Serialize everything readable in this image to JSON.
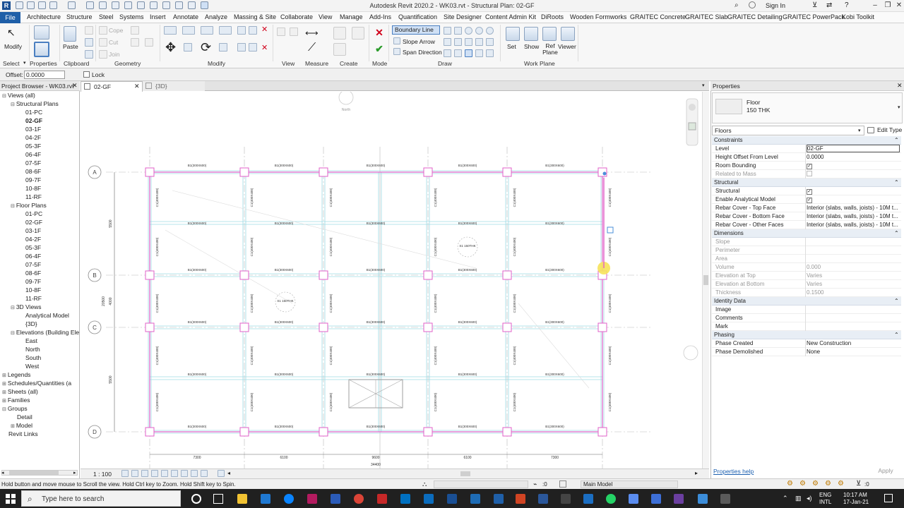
{
  "title": "Autodesk Revit 2020.2 - WK03.rvt - Structural Plan: 02-GF",
  "signin": "Sign In",
  "menu": [
    "File",
    "Architecture",
    "Structure",
    "Steel",
    "Systems",
    "Insert",
    "Annotate",
    "Analyze",
    "Massing & Site",
    "Collaborate",
    "View",
    "Manage",
    "Add-Ins",
    "Quantification",
    "Site Designer",
    "Content Admin Kit",
    "DiRoots",
    "Wooden Formworks",
    "GRAITEC Concrete",
    "GRAITEC Slab",
    "GRAITEC Detailing",
    "GRAITEC PowerPack",
    "Kobi Toolkit"
  ],
  "ribbon": {
    "modify": "Modify",
    "paste": "Paste",
    "cope": "Cope",
    "cut": "Cut",
    "join": "Join",
    "boundary_line": "Boundary Line",
    "slope_arrow": "Slope Arrow",
    "span_direction": "Span Direction",
    "set": "Set",
    "show": "Show",
    "ref_plane": "Ref Plane",
    "viewer": "Viewer",
    "groups": {
      "select": "Select",
      "properties": "Properties",
      "clipboard": "Clipboard",
      "geometry": "Geometry",
      "modify": "Modify",
      "view": "View",
      "measure": "Measure",
      "create": "Create",
      "mode": "Mode",
      "draw": "Draw",
      "work_plane": "Work Plane"
    }
  },
  "options": {
    "offset_label": "Offset:",
    "offset_value": "0.0000",
    "lock_label": "Lock"
  },
  "project_browser": {
    "title": "Project Browser - WK03.rvt",
    "items": [
      {
        "label": "Views (all)",
        "indent": 0,
        "tw": "⊟"
      },
      {
        "label": "Structural Plans",
        "indent": 1,
        "tw": "⊟"
      },
      {
        "label": "01-PC",
        "indent": 2
      },
      {
        "label": "02-GF",
        "indent": 2,
        "bold": true
      },
      {
        "label": "03-1F",
        "indent": 2
      },
      {
        "label": "04-2F",
        "indent": 2
      },
      {
        "label": "05-3F",
        "indent": 2
      },
      {
        "label": "06-4F",
        "indent": 2
      },
      {
        "label": "07-5F",
        "indent": 2
      },
      {
        "label": "08-6F",
        "indent": 2
      },
      {
        "label": "09-7F",
        "indent": 2
      },
      {
        "label": "10-8F",
        "indent": 2
      },
      {
        "label": "11-RF",
        "indent": 2
      },
      {
        "label": "Floor Plans",
        "indent": 1,
        "tw": "⊟"
      },
      {
        "label": "01-PC",
        "indent": 2
      },
      {
        "label": "02-GF",
        "indent": 2
      },
      {
        "label": "03-1F",
        "indent": 2
      },
      {
        "label": "04-2F",
        "indent": 2
      },
      {
        "label": "05-3F",
        "indent": 2
      },
      {
        "label": "06-4F",
        "indent": 2
      },
      {
        "label": "07-5F",
        "indent": 2
      },
      {
        "label": "08-6F",
        "indent": 2
      },
      {
        "label": "09-7F",
        "indent": 2
      },
      {
        "label": "10-8F",
        "indent": 2
      },
      {
        "label": "11-RF",
        "indent": 2
      },
      {
        "label": "3D Views",
        "indent": 1,
        "tw": "⊟"
      },
      {
        "label": "Analytical Model",
        "indent": 2
      },
      {
        "label": "{3D}",
        "indent": 2
      },
      {
        "label": "Elevations (Building Ele",
        "indent": 1,
        "tw": "⊟"
      },
      {
        "label": "East",
        "indent": 2
      },
      {
        "label": "North",
        "indent": 2
      },
      {
        "label": "South",
        "indent": 2
      },
      {
        "label": "West",
        "indent": 2
      },
      {
        "label": "Legends",
        "indent": 0,
        "tw": "⊞"
      },
      {
        "label": "Schedules/Quantities (a",
        "indent": 0,
        "tw": "⊞"
      },
      {
        "label": "Sheets (all)",
        "indent": 0,
        "tw": "⊞"
      },
      {
        "label": "Families",
        "indent": 0,
        "tw": "⊞"
      },
      {
        "label": "Groups",
        "indent": 0,
        "tw": "⊟"
      },
      {
        "label": "Detail",
        "indent": 1
      },
      {
        "label": "Model",
        "indent": 1,
        "tw": "⊞"
      },
      {
        "label": "Revit Links",
        "indent": 0
      }
    ]
  },
  "tabs": [
    {
      "label": "02-GF",
      "active": true
    },
    {
      "label": "{3D}"
    }
  ],
  "canvas": {
    "north": "North",
    "grid_rows": [
      "A",
      "B",
      "C",
      "D"
    ],
    "dims_left": [
      "5500",
      "20500",
      "4000",
      "5500"
    ],
    "dims_bottom": [
      "7300",
      "6100",
      "9600",
      "6100",
      "7300"
    ],
    "dim_total": "34400",
    "beam_label": "B1(300X600)",
    "column_label": "C1(400X400)",
    "slab_note": "S1 150THK"
  },
  "view_scale": "1 : 100",
  "properties": {
    "title": "Properties",
    "family": "Floor",
    "type": "150 THK",
    "filter": "Floors",
    "edit_type": "Edit Type",
    "help": "Properties help",
    "apply": "Apply",
    "sections": [
      {
        "name": "Constraints",
        "rows": [
          {
            "k": "Level",
            "v": "02-GF"
          },
          {
            "k": "Height Offset From Level",
            "v": "0.0000"
          },
          {
            "k": "Room Bounding",
            "chk": true
          },
          {
            "k": "Related to Mass",
            "chk": false,
            "grey": true
          }
        ]
      },
      {
        "name": "Structural",
        "rows": [
          {
            "k": "Structural",
            "chk": true
          },
          {
            "k": "Enable Analytical Model",
            "chk": true
          },
          {
            "k": "Rebar Cover - Top Face",
            "v": "Interior (slabs, walls, joists) - 10M t..."
          },
          {
            "k": "Rebar Cover - Bottom Face",
            "v": "Interior (slabs, walls, joists) - 10M t..."
          },
          {
            "k": "Rebar Cover - Other Faces",
            "v": "Interior (slabs, walls, joists) - 10M t..."
          }
        ]
      },
      {
        "name": "Dimensions",
        "rows": [
          {
            "k": "Slope",
            "v": "",
            "grey": true
          },
          {
            "k": "Perimeter",
            "v": "",
            "grey": true
          },
          {
            "k": "Area",
            "v": "",
            "grey": true
          },
          {
            "k": "Volume",
            "v": "0.000",
            "grey": true
          },
          {
            "k": "Elevation at Top",
            "v": "Varies",
            "grey": true
          },
          {
            "k": "Elevation at Bottom",
            "v": "Varies",
            "grey": true
          },
          {
            "k": "Thickness",
            "v": "0.1500",
            "grey": true
          }
        ]
      },
      {
        "name": "Identity Data",
        "rows": [
          {
            "k": "Image",
            "v": ""
          },
          {
            "k": "Comments",
            "v": ""
          },
          {
            "k": "Mark",
            "v": ""
          }
        ]
      },
      {
        "name": "Phasing",
        "rows": [
          {
            "k": "Phase Created",
            "v": "New Construction"
          },
          {
            "k": "Phase Demolished",
            "v": "None"
          }
        ]
      }
    ]
  },
  "status": {
    "message": "Hold button and move mouse to Scroll the view. Hold Ctrl key to Zoom. Hold Shift key to Spin.",
    "zero": ":0",
    "model": "Main Model",
    "filter": ":0"
  },
  "taskbar": {
    "search_placeholder": "Type here to search",
    "time": "10:17 AM",
    "date": "17-Jan-21",
    "lang": "ENG",
    "lang2": "INTL"
  }
}
